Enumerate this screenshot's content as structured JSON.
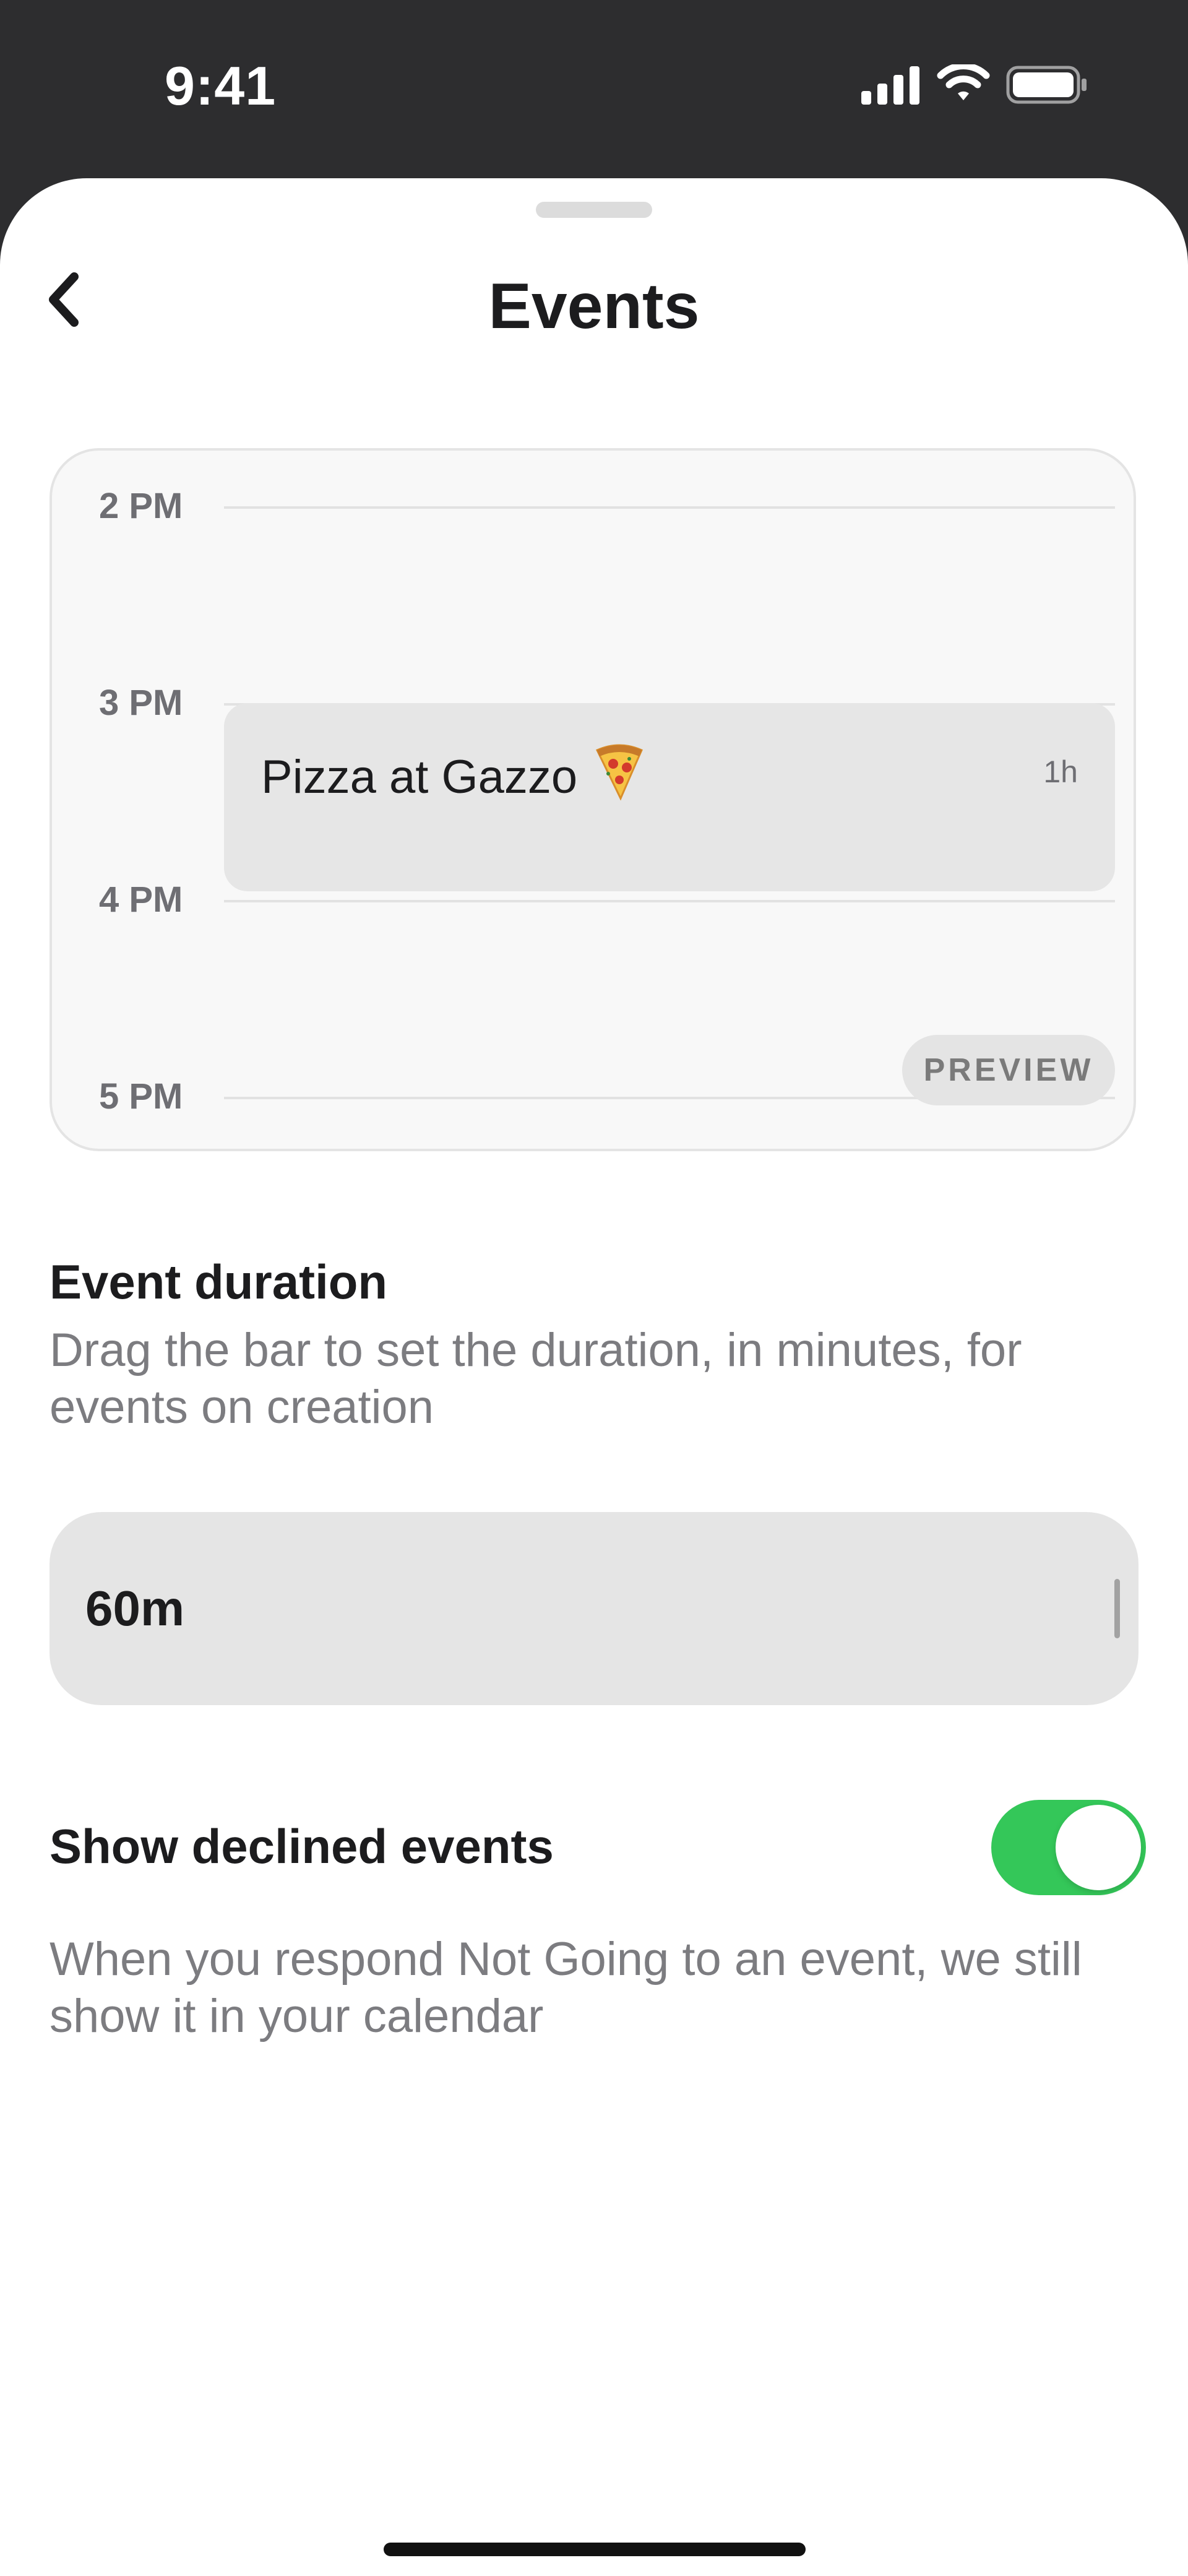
{
  "status_bar": {
    "time": "9:41",
    "icons": [
      "cellular-signal-icon",
      "wifi-icon",
      "battery-icon"
    ]
  },
  "header": {
    "title": "Events",
    "back_icon": "chevron-left-icon"
  },
  "preview": {
    "time_labels": [
      "2 PM",
      "3 PM",
      "4 PM",
      "5 PM"
    ],
    "event": {
      "title": "Pizza at Gazzo",
      "emoji": "🍕",
      "length": "1h"
    },
    "badge": "PREVIEW"
  },
  "event_duration": {
    "heading": "Event duration",
    "description": "Drag the bar to set the duration, in minutes, for events on creation",
    "value": "60m"
  },
  "declined_events": {
    "heading": "Show declined events",
    "description": "When you respond Not Going to an event, we still show it in your calendar",
    "enabled": true
  },
  "colors": {
    "toggle_on": "#34c759",
    "status_bar_bg": "#2d2d2f"
  }
}
